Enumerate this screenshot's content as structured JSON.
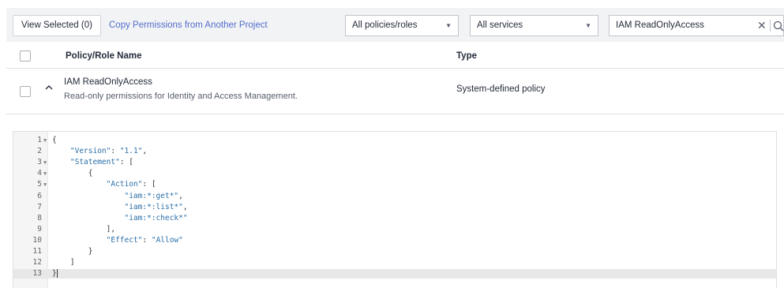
{
  "toolbar": {
    "view_selected_label": "View Selected (0)",
    "copy_permissions_label": "Copy Permissions from Another Project",
    "policy_filter": {
      "selected": "All policies/roles"
    },
    "service_filter": {
      "selected": "All services"
    },
    "search": {
      "value": "IAM ReadOnlyAccess"
    }
  },
  "table": {
    "columns": {
      "name": "Policy/Role Name",
      "type": "Type"
    },
    "rows": [
      {
        "name": "IAM ReadOnlyAccess",
        "description": "Read-only permissions for Identity and Access Management.",
        "type": "System-defined policy",
        "expanded": true
      }
    ]
  },
  "policy_json": {
    "lines": [
      {
        "num": "1",
        "fold": true,
        "text": "{"
      },
      {
        "num": "2",
        "fold": false,
        "text": "    \"Version\": \"1.1\","
      },
      {
        "num": "3",
        "fold": true,
        "text": "    \"Statement\": ["
      },
      {
        "num": "4",
        "fold": true,
        "text": "        {"
      },
      {
        "num": "5",
        "fold": true,
        "text": "            \"Action\": ["
      },
      {
        "num": "6",
        "fold": false,
        "text": "                \"iam:*:get*\","
      },
      {
        "num": "7",
        "fold": false,
        "text": "                \"iam:*:list*\","
      },
      {
        "num": "8",
        "fold": false,
        "text": "                \"iam:*:check*\""
      },
      {
        "num": "9",
        "fold": false,
        "text": "            ],"
      },
      {
        "num": "10",
        "fold": false,
        "text": "            \"Effect\": \"Allow\""
      },
      {
        "num": "11",
        "fold": false,
        "text": "        }"
      },
      {
        "num": "12",
        "fold": false,
        "text": "    ]"
      },
      {
        "num": "13",
        "fold": false,
        "text": "}",
        "active": true
      }
    ]
  },
  "colors": {
    "link": "#526ecc",
    "toolbar_bg": "#f2f3f5",
    "string": "#2a6fa8"
  },
  "icons": [
    "clear-icon",
    "search-icon",
    "chevron-up-icon",
    "caret-down-icon",
    "fold-arrow-icon"
  ]
}
